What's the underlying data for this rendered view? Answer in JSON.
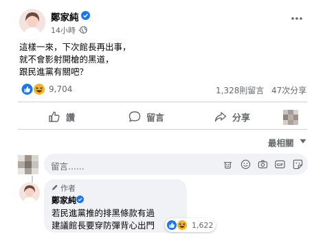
{
  "post": {
    "author": "鄭家純",
    "timestamp": "14小時",
    "separator": "·",
    "lines": [
      "這樣一來，下次館長再出事，",
      "就不會影射開槍的黑道，",
      "跟民進黨有關吧？"
    ],
    "reactions_count": "9,704",
    "comments_count": "1,328則留言",
    "shares_count": "47次分享"
  },
  "actions": {
    "like": "讚",
    "comment": "留言",
    "share": "分享"
  },
  "comments": {
    "sort_label": "最相關",
    "input_placeholder": "留言......"
  },
  "reply": {
    "badge": "作者",
    "author": "鄭家純",
    "lines": [
      "若民進黨推的排黑條款有過",
      "建議館長要穿防彈背心出門"
    ],
    "reactions_count": "1,622"
  },
  "colors": {
    "like_blue": "#1877f2",
    "haha_yellow": "#f7b125",
    "secondary_text": "#65676b",
    "bubble_bg": "#f0f2f5"
  },
  "icons": [
    "verified-icon",
    "globe-icon",
    "more-icon",
    "like-icon",
    "haha-icon",
    "comment-icon",
    "share-icon",
    "emoji-icon",
    "camera-icon",
    "gif-icon",
    "sticker-icon",
    "pencil-icon"
  ]
}
